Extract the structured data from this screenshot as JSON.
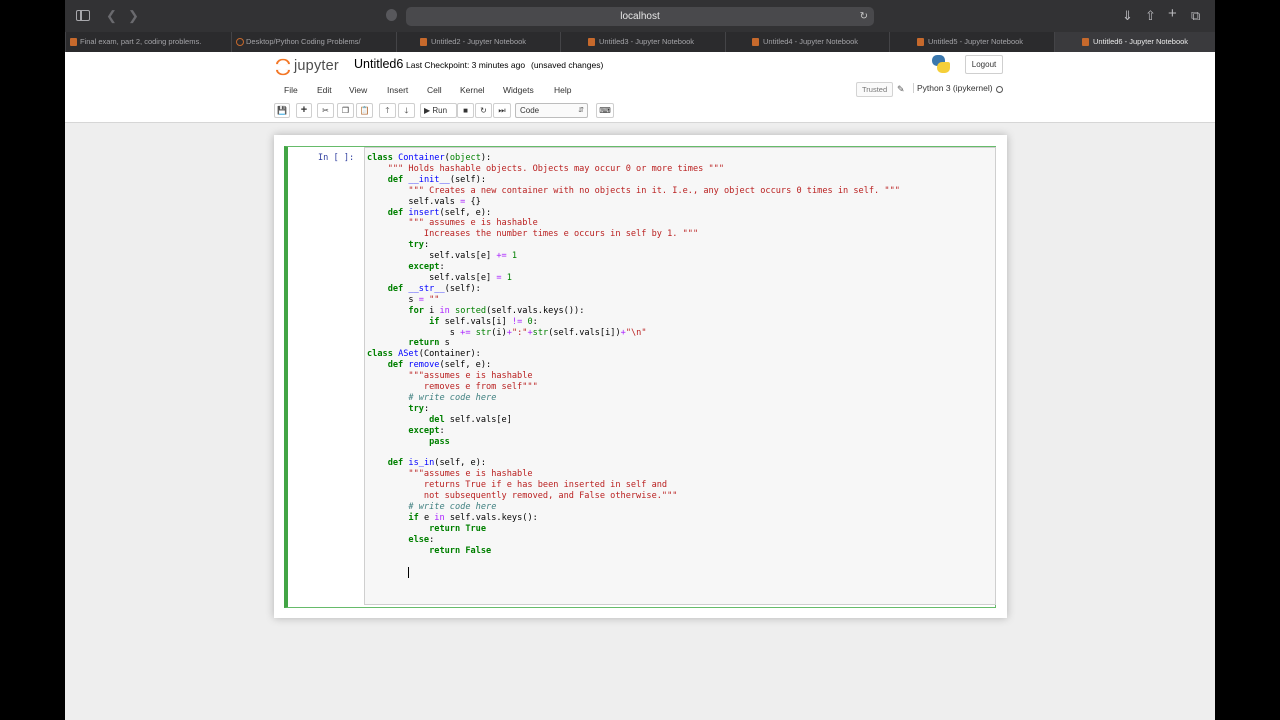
{
  "browser": {
    "url": "localhost",
    "tabs": [
      {
        "label": "Final exam, part 2, coding problems."
      },
      {
        "label": "Desktop/Python Coding Problems/"
      },
      {
        "label": "Untitled2 - Jupyter Notebook"
      },
      {
        "label": "Untitled3 - Jupyter Notebook"
      },
      {
        "label": "Untitled4 - Jupyter Notebook"
      },
      {
        "label": "Untitled5 - Jupyter Notebook"
      },
      {
        "label": "Untitled6 - Jupyter Notebook"
      }
    ]
  },
  "header": {
    "logo_text": "jupyter",
    "notebook_name": "Untitled6",
    "checkpoint": "Last Checkpoint: 3 minutes ago",
    "autosave": "(unsaved changes)",
    "logout": "Logout"
  },
  "menubar": {
    "items": [
      "File",
      "Edit",
      "View",
      "Insert",
      "Cell",
      "Kernel",
      "Widgets",
      "Help"
    ],
    "trusted": "Trusted",
    "kernel": "Python 3 (ipykernel)"
  },
  "toolbar": {
    "run_label": "Run",
    "cell_type": "Code"
  },
  "cell": {
    "prompt": "In [ ]:"
  }
}
